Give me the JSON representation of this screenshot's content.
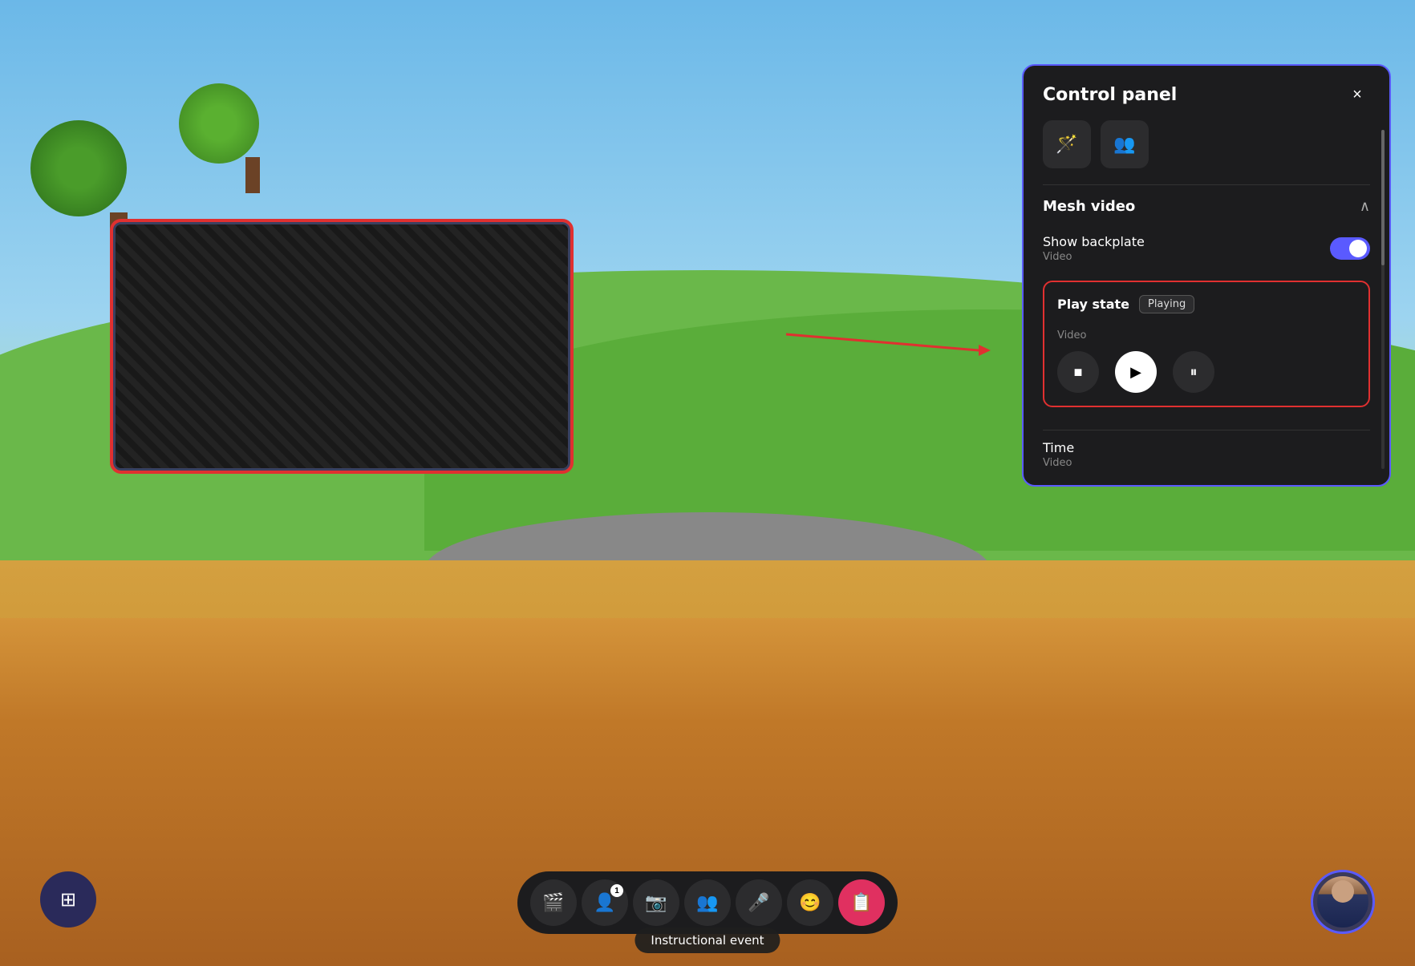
{
  "scene": {
    "bg_description": "3D virtual environment with trees, grass, and wooden table"
  },
  "control_panel": {
    "title": "Control panel",
    "close_label": "×",
    "icons": [
      {
        "name": "magic-wand-icon",
        "symbol": "🪄"
      },
      {
        "name": "group-icon",
        "symbol": "👥"
      }
    ],
    "mesh_video": {
      "section_title": "Mesh video",
      "chevron": "∧",
      "show_backplate": {
        "label": "Show backplate",
        "sublabel": "Video",
        "toggle_on": true
      },
      "play_state": {
        "label": "Play state",
        "sublabel": "Video",
        "status_badge": "Playing",
        "controls": {
          "stop_label": "■",
          "play_label": "▶",
          "pause_label": "⏸"
        }
      },
      "time": {
        "label": "Time",
        "sublabel": "Video"
      }
    }
  },
  "toolbar": {
    "buttons": [
      {
        "name": "scene-btn",
        "symbol": "🎬",
        "badge": null
      },
      {
        "name": "participants-btn",
        "symbol": "👤",
        "badge": "1"
      },
      {
        "name": "camera-btn",
        "symbol": "📷",
        "badge": null
      },
      {
        "name": "people-btn",
        "symbol": "👥",
        "badge": null
      },
      {
        "name": "mic-btn",
        "symbol": "🎤",
        "badge": null
      },
      {
        "name": "emoji-btn",
        "symbol": "😊",
        "badge": null
      },
      {
        "name": "screen-share-btn",
        "symbol": "📋",
        "badge": null,
        "active": true
      }
    ],
    "grid_btn_symbol": "⊞",
    "avatar_alt": "User avatar"
  },
  "event_badge": {
    "label": "Instructional event"
  }
}
